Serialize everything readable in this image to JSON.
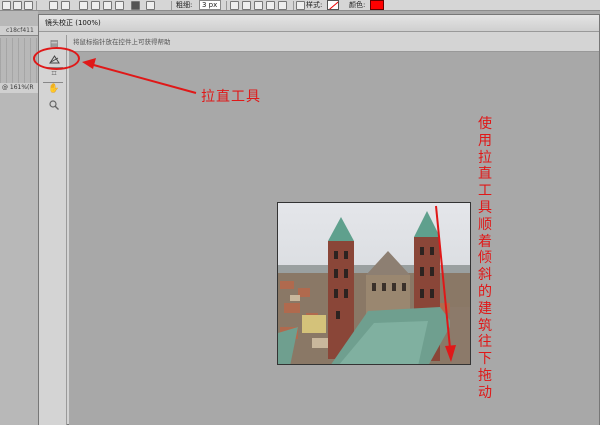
{
  "options_bar": {
    "brush_label": "粗细:",
    "brush_value": "3 px",
    "style_label": "样式:",
    "color_label": "颜色:",
    "color_value": "#ff0000"
  },
  "background_document": {
    "tab_text": "c18cf411",
    "zoom_text": "@ 161%(R"
  },
  "dialog": {
    "title": "镜头校正 (100%)",
    "hint": "将鼠标指针放在控件上可获得帮助",
    "tools": [
      {
        "name": "remove-distortion",
        "icon": "remove-distortion-icon"
      },
      {
        "name": "straighten",
        "icon": "straighten-icon"
      },
      {
        "name": "grid",
        "icon": "grid-icon"
      },
      {
        "name": "hand",
        "icon": "hand-icon"
      },
      {
        "name": "zoom",
        "icon": "zoom-icon"
      }
    ]
  },
  "annotations": {
    "callout_label": "拉直工具",
    "vertical_note": "使用拉直工具顺着倾斜的建筑往下拖动",
    "accent_color": "#e01818"
  }
}
